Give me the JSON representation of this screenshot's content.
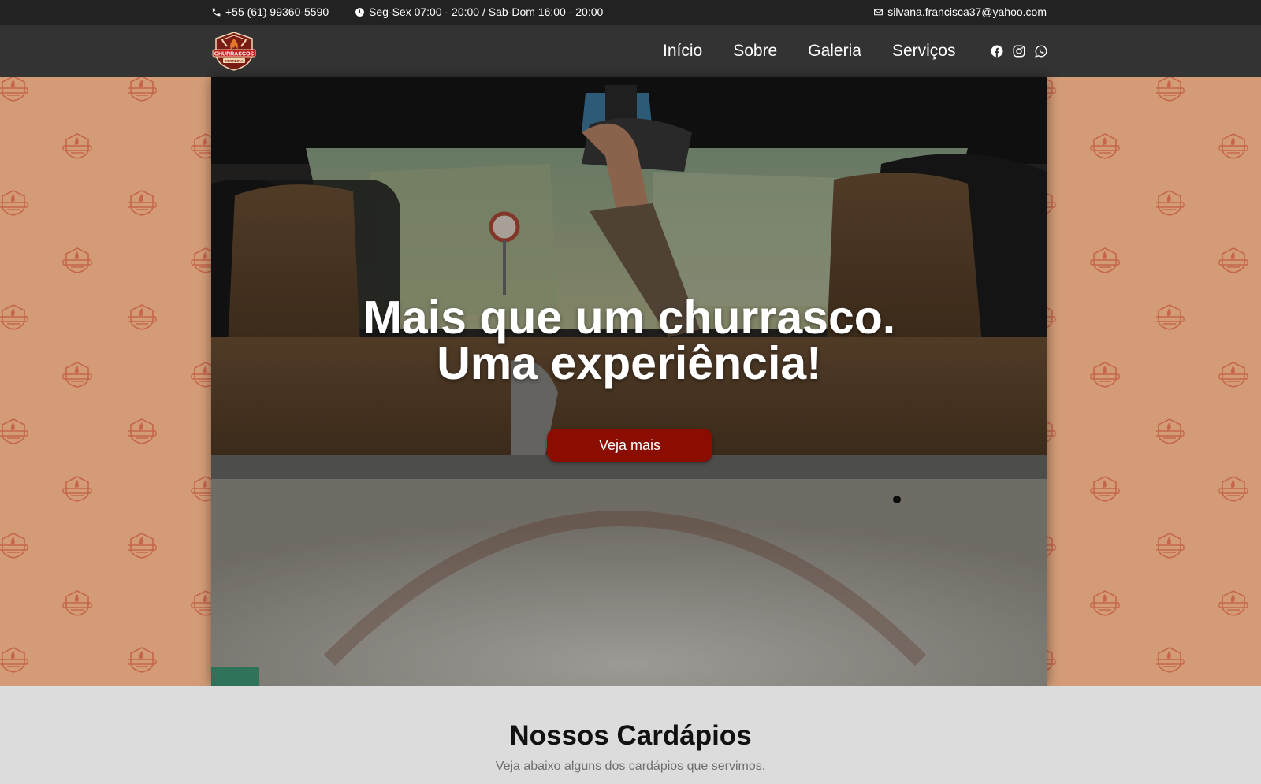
{
  "topbar": {
    "phone": "+55 (61) 99360-5590",
    "hours": "Seg-Sex 07:00 - 20:00 / Sab-Dom 16:00 - 20:00",
    "email": "silvana.francisca37@yahoo.com",
    "icons": [
      "phone-icon",
      "clock-icon",
      "mail-icon"
    ]
  },
  "brand": {
    "logo_top_text": "CHURRASCOS",
    "logo_bottom_text": "FERREIRA",
    "logo_colors": {
      "shield": "#7a1c16",
      "banner": "#c0201a",
      "flame": "#e0782a"
    }
  },
  "nav": {
    "items": [
      {
        "label": "Início"
      },
      {
        "label": "Sobre"
      },
      {
        "label": "Galeria"
      },
      {
        "label": "Serviços"
      }
    ],
    "social": [
      "facebook-icon",
      "instagram-icon",
      "whatsapp-icon"
    ]
  },
  "hero": {
    "title_line1": "Mais que um churrasco.",
    "title_line2": "Uma experiência!",
    "cta_label": "Veja mais"
  },
  "menus_section": {
    "title": "Nossos Cardápios",
    "subtitle": "Veja abaixo alguns dos cardápios que servimos."
  },
  "colors": {
    "topbar_bg": "#222222",
    "navbar_bg": "#333333",
    "pattern_bg": "#d39c77",
    "pattern_mark": "#c5654b",
    "cta_bg": "#8b0c00",
    "section_bg": "#dcdcdc"
  }
}
